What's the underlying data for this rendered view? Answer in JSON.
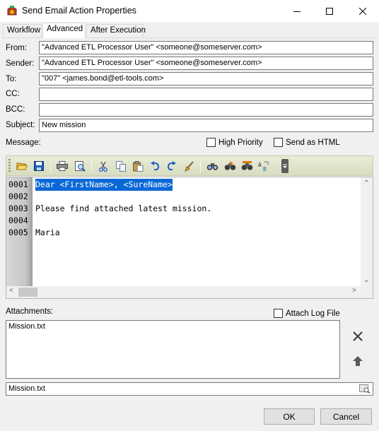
{
  "window": {
    "title": "Send Email Action Properties",
    "buttons": {
      "minimize": "minimize-icon",
      "maximize": "maximize-icon",
      "close": "close-icon"
    }
  },
  "tabs": [
    {
      "label": "Workflow",
      "active": false
    },
    {
      "label": "Advanced",
      "active": true
    },
    {
      "label": "After Execution",
      "active": false
    }
  ],
  "form": {
    "from_label": "From:",
    "from_value": "\"Advanced ETL Processor User\" <someone@someserver.com>",
    "sender_label": "Sender:",
    "sender_value": "\"Advanced ETL Processor User\" <someone@someserver.com>",
    "to_label": "To:",
    "to_value": "\"007\" <james.bond@etl-tools.com>",
    "cc_label": "CC:",
    "cc_value": "",
    "bcc_label": "BCC:",
    "bcc_value": "",
    "subject_label": "Subject:",
    "subject_value": "New mission",
    "message_label": "Message:",
    "high_priority_label": "High Priority",
    "send_html_label": "Send as HTML"
  },
  "toolbar": {
    "icons": [
      "open-icon",
      "save-icon",
      "print-icon",
      "print-preview-icon",
      "cut-icon",
      "copy-icon",
      "paste-icon",
      "undo-icon",
      "redo-icon",
      "clear-icon",
      "find-icon",
      "find-next-icon",
      "replace-icon",
      "goto-icon",
      "more-icon"
    ]
  },
  "editor": {
    "lines": [
      {
        "num": "0001",
        "text": "Dear <FirstName>, <SureName>",
        "selected": true
      },
      {
        "num": "0002",
        "text": "",
        "selected": false
      },
      {
        "num": "0003",
        "text": "Please find attached latest mission.",
        "selected": false
      },
      {
        "num": "0004",
        "text": "",
        "selected": false
      },
      {
        "num": "0005",
        "text": "Maria",
        "selected": false
      }
    ]
  },
  "attachments": {
    "label": "Attachments:",
    "attach_log_label": "Attach Log File",
    "items": [
      "Mission.txt"
    ],
    "current_file": "Mission.txt"
  },
  "footer": {
    "ok_label": "OK",
    "cancel_label": "Cancel"
  }
}
